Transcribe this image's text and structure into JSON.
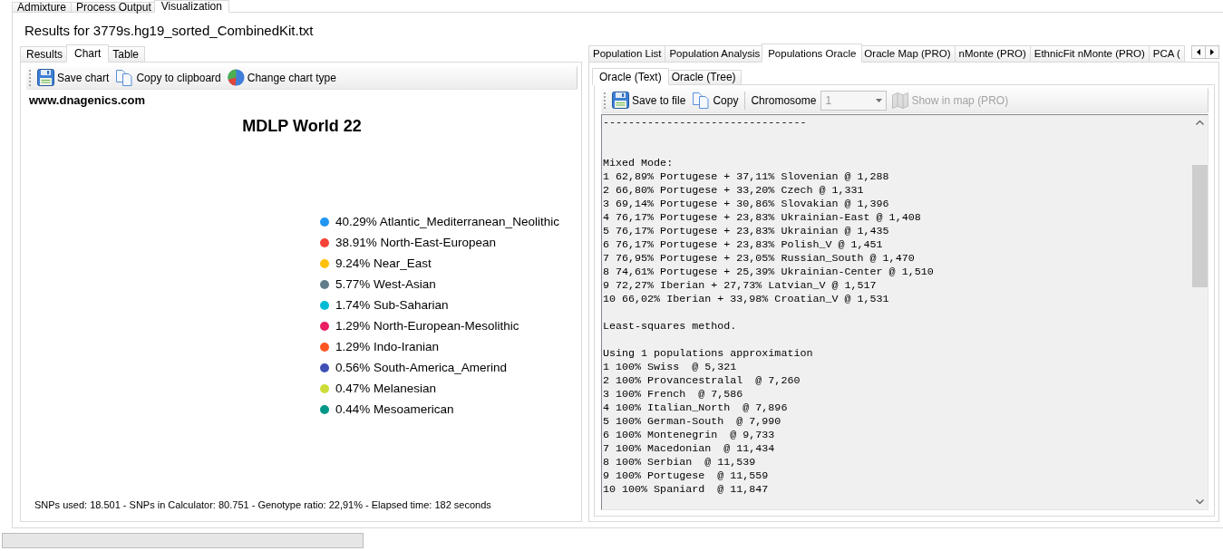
{
  "main_tabs": [
    {
      "label": "Admixture",
      "selected": false
    },
    {
      "label": "Process Output",
      "selected": false
    },
    {
      "label": "Visualization",
      "selected": true
    }
  ],
  "results_title": "Results for 3779s.hg19_sorted_CombinedKit.txt",
  "left_panel": {
    "tabs": [
      {
        "label": "Results",
        "selected": false
      },
      {
        "label": "Chart",
        "selected": true
      },
      {
        "label": "Table",
        "selected": false
      }
    ],
    "toolbar": [
      {
        "kind": "save",
        "label": "Save chart"
      },
      {
        "kind": "copy",
        "label": "Copy to clipboard"
      },
      {
        "kind": "chart_type",
        "label": "Change chart type"
      }
    ],
    "site_label": "www.dnagenics.com",
    "chart_title": "MDLP World 22",
    "legend": [
      {
        "label": "40.29% Atlantic_Mediterranean_Neolithic",
        "color": "#2196f3"
      },
      {
        "label": "38.91% North-East-European",
        "color": "#f44336"
      },
      {
        "label": "9.24% Near_East",
        "color": "#ffc107"
      },
      {
        "label": "5.77% West-Asian",
        "color": "#607d8b"
      },
      {
        "label": "1.74% Sub-Saharian",
        "color": "#00bcd4"
      },
      {
        "label": "1.29% North-European-Mesolithic",
        "color": "#e91e63"
      },
      {
        "label": "1.29% Indo-Iranian",
        "color": "#ff5722"
      },
      {
        "label": "0.56% South-America_Amerind",
        "color": "#3f51b5"
      },
      {
        "label": "0.47% Melanesian",
        "color": "#cddc39"
      },
      {
        "label": "0.44% Mesoamerican",
        "color": "#009688"
      }
    ],
    "footer": "SNPs used: 18.501 - SNPs in Calculator: 80.751 - Genotype ratio: 22,91% - Elapsed time: 182 seconds"
  },
  "right_panel": {
    "tabs": [
      {
        "label": "Population List",
        "selected": false
      },
      {
        "label": "Population Analysis",
        "selected": false
      },
      {
        "label": "Populations Oracle",
        "selected": true
      },
      {
        "label": "Oracle Map (PRO)",
        "selected": false
      },
      {
        "label": "nMonte (PRO)",
        "selected": false
      },
      {
        "label": "EthnicFit nMonte (PRO)",
        "selected": false
      },
      {
        "label": "PCA (",
        "selected": false
      }
    ],
    "subtabs": [
      {
        "label": "Oracle (Text)",
        "selected": true
      },
      {
        "label": "Oracle (Tree)",
        "selected": false
      }
    ],
    "toolbar": [
      {
        "kind": "save",
        "label": "Save to file",
        "disabled": false
      },
      {
        "kind": "copy",
        "label": "Copy",
        "disabled": false
      },
      {
        "kind": "separator"
      },
      {
        "kind": "dropdown",
        "label": "Chromosome",
        "value": "1",
        "disabled": true
      },
      {
        "kind": "map",
        "label": "Show in map (PRO)",
        "disabled": true
      }
    ],
    "output": [
      {
        "kind": "rule",
        "lines": [
          "--------------------------------"
        ]
      },
      {
        "kind": "section",
        "lines": [
          "Mixed Mode:",
          "1 62,89% Portugese + 37,11% Slovenian @ 1,288",
          "2 66,80% Portugese + 33,20% Czech @ 1,331",
          "3 69,14% Portugese + 30,86% Slovakian @ 1,396",
          "4 76,17% Portugese + 23,83% Ukrainian-East @ 1,408",
          "5 76,17% Portugese + 23,83% Ukrainian @ 1,435",
          "6 76,17% Portugese + 23,83% Polish_V @ 1,451",
          "7 76,95% Portugese + 23,05% Russian_South @ 1,470",
          "8 74,61% Portugese + 25,39% Ukrainian-Center @ 1,510",
          "9 72,27% Iberian + 27,73% Latvian_V @ 1,517",
          "10 66,02% Iberian + 33,98% Croatian_V @ 1,531"
        ]
      },
      {
        "kind": "section",
        "lines": [
          "Least-squares method."
        ]
      },
      {
        "kind": "section",
        "lines": [
          "Using 1 populations approximation",
          "1 100% Swiss  @ 5,321",
          "2 100% Provancestralal  @ 7,260",
          "3 100% French  @ 7,586",
          "4 100% Italian_North  @ 7,896",
          "5 100% German-South  @ 7,990",
          "6 100% Montenegrin  @ 9,733",
          "7 100% Macedonian  @ 11,434",
          "8 100% Serbian  @ 11,539",
          "9 100% Portugese  @ 11,559",
          "10 100% Spaniard  @ 11,847"
        ]
      }
    ]
  },
  "progress_bar": {
    "level": 0
  }
}
